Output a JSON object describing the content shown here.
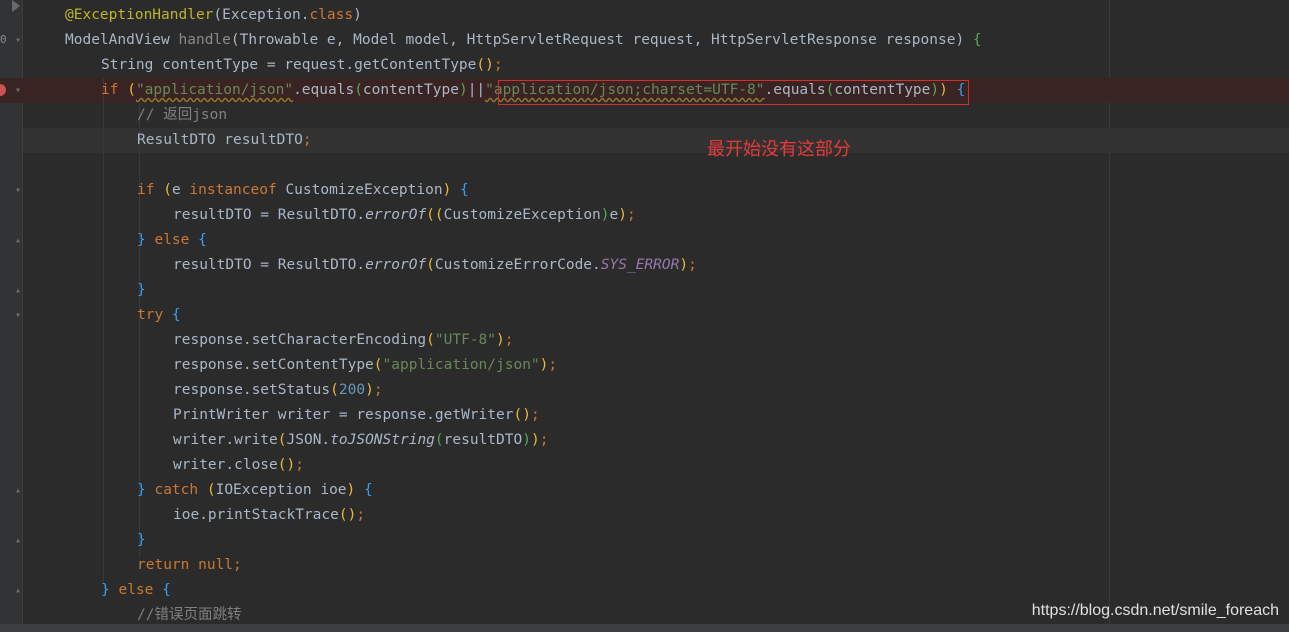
{
  "gutter": {
    "line_number_visible": "0"
  },
  "annotation_note": "最开始没有这部分",
  "watermark": "https://blog.csdn.net/smile_foreach",
  "code_lines": [
    {
      "id": "l1"
    },
    {
      "id": "l2"
    }
  ],
  "tokens": {
    "l1_ann": "@ExceptionHandler",
    "l1_p": "(",
    "l1_a": "Exception.",
    "l1_kw": "class",
    "l1_c": ")",
    "l2_a": "ModelAndView ",
    "l2_fn": "handle",
    "l2_b": "(Throwable e, Model model, HttpServletRequest request, HttpServletResponse response) ",
    "l2_br": "{",
    "l3_a": "String contentType = request.getContentType",
    "l3_p": "()",
    "l3_s": ";",
    "l4_kw": "if ",
    "l4_p1": "(",
    "l4_s1": "\"application/json\"",
    "l4_b": ".equals",
    "l4_p2": "(",
    "l4_c": "contentType",
    "l4_p3": ")",
    "l4_or": "||",
    "l4_s2": "\"application/json;charset=UTF-8\"",
    "l4_d": ".equals",
    "l4_p4": "(",
    "l4_e": "contentType",
    "l4_p5": ")",
    "l4_p6": ")",
    "l4_br": " {",
    "l5_cmt": "// 返回json",
    "l6_a": "ResultDTO resultDTO",
    "l6_s": ";",
    "l8_kw": "if ",
    "l8_p": "(",
    "l8_a": "e ",
    "l8_kw2": "instanceof ",
    "l8_b": "CustomizeException",
    "l8_p2": ")",
    "l8_br": " {",
    "l9_a": "resultDTO = ResultDTO.",
    "l9_it": "errorOf",
    "l9_p": "((",
    "l9_b": "CustomizeException",
    "l9_p2": ")",
    "l9_c": "e",
    "l9_p3": ")",
    "l9_s": ";",
    "l10_br": "} ",
    "l10_kw": "else ",
    "l10_br2": "{",
    "l11_a": "resultDTO = ResultDTO.",
    "l11_it": "errorOf",
    "l11_p": "(",
    "l11_b": "CustomizeErrorCode.",
    "l11_st": "SYS_ERROR",
    "l11_p2": ")",
    "l11_s": ";",
    "l12_br": "}",
    "l13_kw": "try ",
    "l13_br": "{",
    "l14_a": "response.setCharacterEncoding",
    "l14_p": "(",
    "l14_str": "\"UTF-8\"",
    "l14_p2": ")",
    "l14_s": ";",
    "l15_a": "response.setContentType",
    "l15_p": "(",
    "l15_str": "\"application/json\"",
    "l15_p2": ")",
    "l15_s": ";",
    "l16_a": "response.setStatus",
    "l16_p": "(",
    "l16_num": "200",
    "l16_p2": ")",
    "l16_s": ";",
    "l17_a": "PrintWriter writer = response.getWriter",
    "l17_p": "()",
    "l17_s": ";",
    "l18_a": "writer.write",
    "l18_p": "(",
    "l18_b": "JSON.",
    "l18_it": "toJSONString",
    "l18_p2": "(",
    "l18_c": "resultDTO",
    "l18_p3": ")",
    "l18_p4": ")",
    "l18_s": ";",
    "l19_a": "writer.close",
    "l19_p": "()",
    "l19_s": ";",
    "l20_br": "} ",
    "l20_kw": "catch ",
    "l20_p": "(",
    "l20_a": "IOException ioe",
    "l20_p2": ")",
    "l20_br2": " {",
    "l21_a": "ioe.printStackTrace",
    "l21_p": "()",
    "l21_s": ";",
    "l22_br": "}",
    "l23_kw": "return null",
    "l23_s": ";",
    "l24_br": "} ",
    "l24_kw": "else ",
    "l24_br2": "{",
    "l25_cmt": "//错误页面跳转"
  },
  "colors": {
    "background": "#2b2b2b",
    "keyword": "#cc7832",
    "string": "#6a8759",
    "annotation": "#bbb529",
    "number": "#6897bb",
    "comment": "#808080",
    "static_field": "#9876aa",
    "highlight_box": "#d03030",
    "note_text": "#e83a3a"
  }
}
